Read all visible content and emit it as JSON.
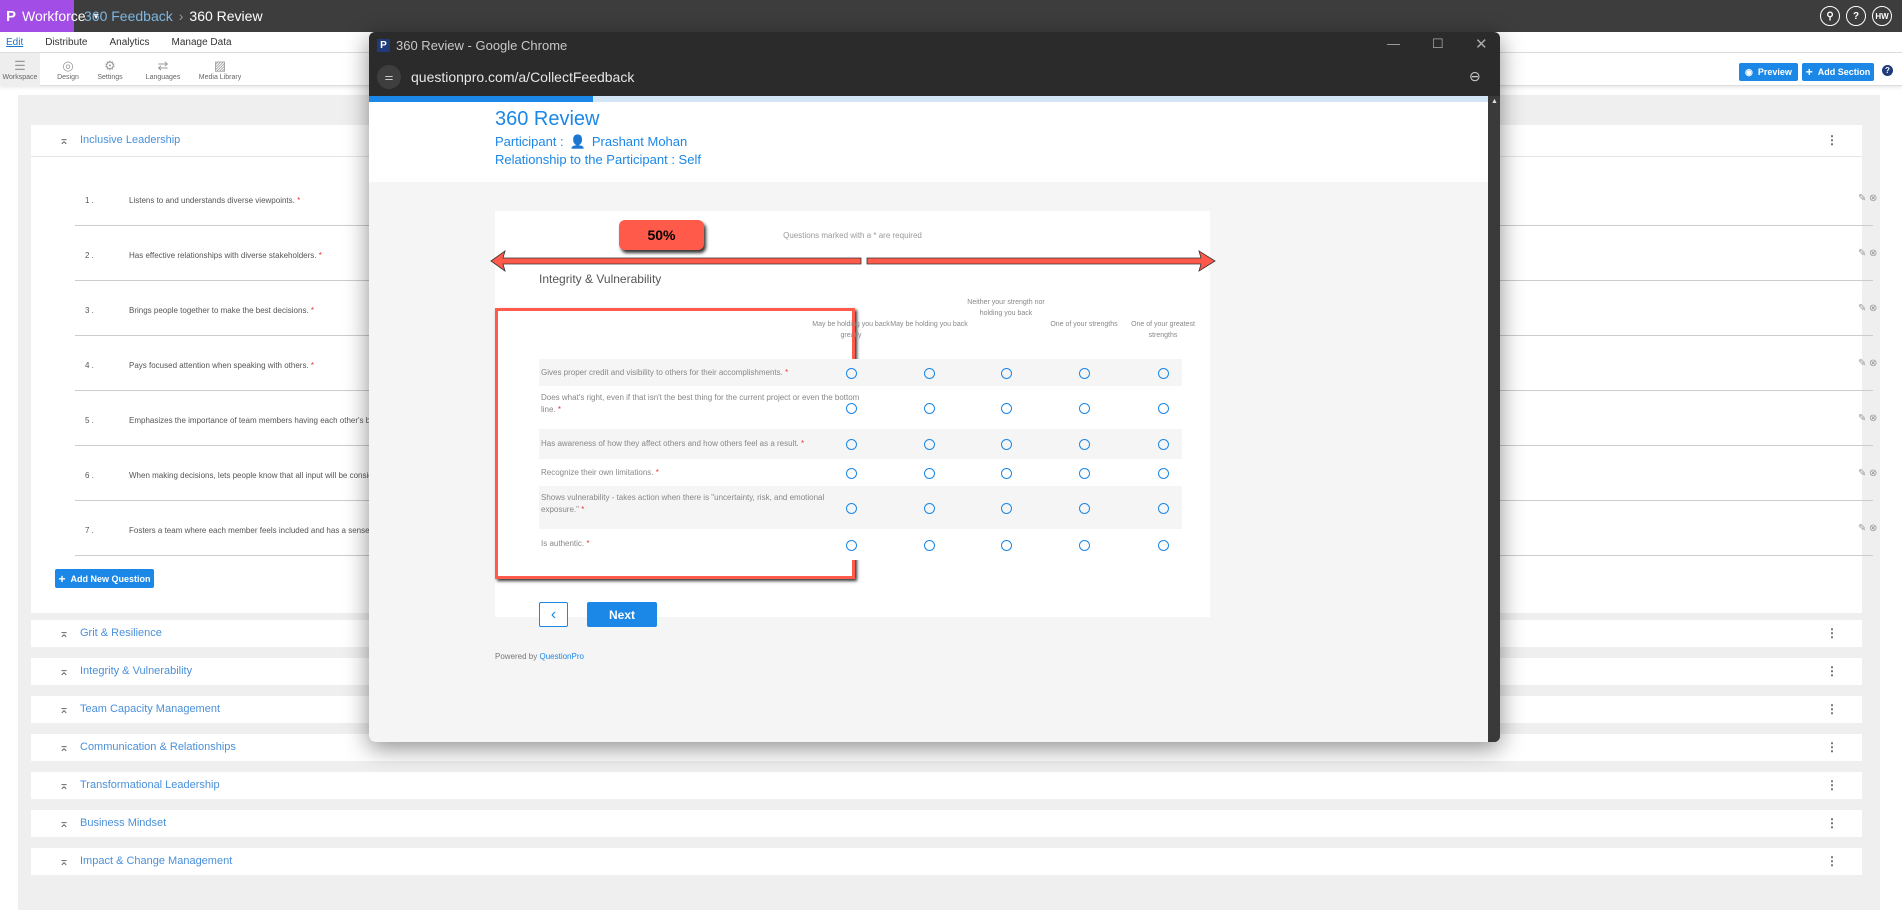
{
  "topbar": {
    "brand": "Workforce",
    "breadcrumb": [
      "360 Feedback",
      "360 Review"
    ],
    "icons": [
      "search-icon",
      "help-icon"
    ],
    "avatar": "HW"
  },
  "menu": [
    "Edit",
    "Distribute",
    "Analytics",
    "Manage Data"
  ],
  "toolbar": {
    "tools": [
      "Workspace",
      "Design",
      "Settings",
      "Languages",
      "Media Library"
    ],
    "preview": "Preview",
    "add_section": "Add Section",
    "help": "?"
  },
  "open_section": {
    "title": "Inclusive Leadership",
    "questions": [
      {
        "num": "1 .",
        "text": "Listens to and understands diverse viewpoints."
      },
      {
        "num": "2 .",
        "text": "Has effective relationships with diverse stakeholders."
      },
      {
        "num": "3 .",
        "text": "Brings people together to make the best decisions."
      },
      {
        "num": "4 .",
        "text": "Pays focused attention when speaking with others."
      },
      {
        "num": "5 .",
        "text": "Emphasizes the importance of team members having each other's best inte"
      },
      {
        "num": "6 .",
        "text": "When making decisions, lets people know that all input will be considered"
      },
      {
        "num": "7 .",
        "text": "Fosters a team where each member feels included and has a sense of belo"
      }
    ],
    "add_question": "Add New Question",
    "required_mark": "*"
  },
  "sections": [
    "Grit & Resilience",
    "Integrity & Vulnerability",
    "Team Capacity Management",
    "Communication & Relationships",
    "Transformational Leadership",
    "Business Mindset",
    "Impact & Change Management"
  ],
  "popup": {
    "window_title": "360 Review - Google Chrome",
    "url": "questionpro.com/a/CollectFeedback",
    "progress": 0.2,
    "survey_title": "360 Review",
    "participant_label": "Participant :",
    "participant_name": "Prashant Mohan",
    "relationship": "Relationship to the Participant : Self",
    "required_note": "Questions marked with a * are required",
    "annotation": "50%",
    "section_title": "Integrity & Vulnerability",
    "columns": [
      "May be holding you back greatly",
      "May be holding you back",
      "Neither your strength nor holding you back",
      "One of your strengths",
      "One of your greatest strengths"
    ],
    "rows": [
      "Gives proper credit and visibility to others for their accomplishments.",
      "Does what's right, even if that isn't the best thing for the current project or even the bottom line.",
      "Has awareness of how they affect others and how others feel as a result.",
      "Recognize their own limitations.",
      "Shows vulnerability - takes action when there is \"uncertainty, risk, and emotional exposure.\"",
      "Is authentic."
    ],
    "next": "Next",
    "powered_by": "Powered by",
    "powered_brand": "QuestionPro"
  },
  "colors": {
    "accent": "#1b87e6",
    "brand": "#a24ee6",
    "annotation": "#ff5a4a"
  }
}
